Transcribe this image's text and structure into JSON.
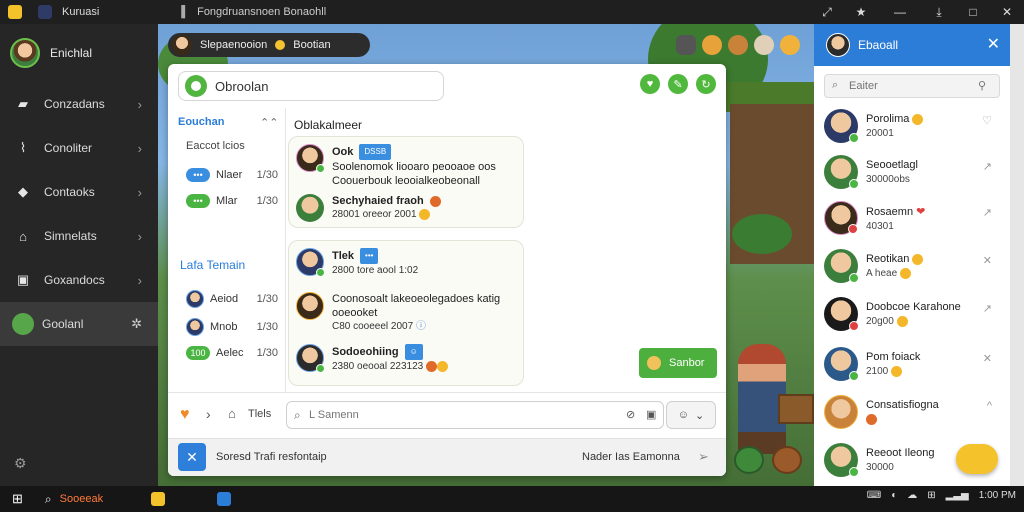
{
  "titlebar": {
    "title": "Kuruasi",
    "tab_title": "Fongdruansnoen Bonaohll",
    "controls": [
      "⤢",
      "★",
      "—",
      "⤓",
      "□",
      "✕"
    ]
  },
  "sidebar": {
    "profile_name": "Enichlal",
    "items": [
      {
        "label": "Conzadans",
        "icon": "contacts-icon"
      },
      {
        "label": "Conoliter",
        "icon": "activity-icon"
      },
      {
        "label": "Contaoks",
        "icon": "chat-icon"
      },
      {
        "label": "Simnelats",
        "icon": "home-icon"
      },
      {
        "label": "Goxandocs",
        "icon": "bag-icon"
      },
      {
        "label": "Goolanl",
        "icon": "game-icon",
        "active": true
      }
    ]
  },
  "game_bar": {
    "name": "Slepaenooion",
    "badge": "Bootian"
  },
  "chat": {
    "header_title": "Obroolan",
    "lists": {
      "section1_title": "Eouchan",
      "section1_sub": "Eaccot lcios",
      "section1_rows": [
        {
          "pill": "•••",
          "name": "Nlaer",
          "time": "1/30",
          "pill_color": "#3a8ee0"
        },
        {
          "pill": "•••",
          "name": "Mlar",
          "time": "1/30",
          "pill_color": "#4bb543"
        }
      ],
      "section2_title": "Lafa Temain",
      "section2_rows": [
        {
          "pill": "",
          "name": "Aeiod",
          "time": "1/30",
          "pill_color": "#3a8ee0"
        },
        {
          "pill": "",
          "name": "Mnob",
          "time": "1/30",
          "pill_color": "#3a8ee0"
        },
        {
          "pill": "100",
          "name": "Aelec",
          "time": "1/30",
          "pill_color": "#4bb543"
        }
      ]
    },
    "conversation_title": "Oblakalmeer",
    "messages": [
      {
        "name": "Ook",
        "tag": "DSSB",
        "text": "Soolenomok liooaro peooaoe oos Coouerbouk leooialkeobeonall",
        "meta": ""
      },
      {
        "name": "",
        "tag": "",
        "text": "Sechyhaied fraoh",
        "meta": "28001 oreeor 2001"
      },
      {
        "name": "Tlek",
        "tag": "•••",
        "text": "",
        "meta": "2800 tore aool 1:02"
      },
      {
        "name": "",
        "tag": "",
        "text": "Coonosoalt lakeoeolegadoes katig ooeooket",
        "meta": "C80 cooeeel 2007"
      },
      {
        "name": "Sodoeohiing",
        "tag": "☺",
        "text": "",
        "meta": "2380 oeooal 223123"
      }
    ],
    "send_button": "Sanbor",
    "input": {
      "label": "Tlels",
      "placeholder": "L Samenn"
    },
    "footer": {
      "left_text": "Soresd Trafi resfontaip",
      "right_text": "Nader  Ias  Eamonna"
    }
  },
  "contacts": {
    "header_name": "Ebaoall",
    "search_placeholder": "Eaiter",
    "items": [
      {
        "name": "Porolima",
        "sub": "20001",
        "status": "#4bb543",
        "action": "♡"
      },
      {
        "name": "Seooetlagl",
        "sub": "30000obs",
        "status": "#4bb543",
        "action": "↗"
      },
      {
        "name": "Rosaemn",
        "sub": "40301",
        "status": "#e04040",
        "action": "↗"
      },
      {
        "name": "Reotikan",
        "sub": "A heae",
        "status": "#4bb543",
        "action": "✕"
      },
      {
        "name": "Doobcoe Karahone",
        "sub": "20g00",
        "status": "#e04040",
        "action": "↗"
      },
      {
        "name": "Pom foiack",
        "sub": "2100",
        "status": "#4bb543",
        "action": "✕"
      },
      {
        "name": "Consatisfiogna",
        "sub": "",
        "status": "#4bb543",
        "action": "^"
      },
      {
        "name": "Reeoot Ileong",
        "sub": "30000",
        "status": "#4bb543",
        "action": ""
      }
    ]
  },
  "taskbar": {
    "search_label": "Sooeeak",
    "tray": [
      "⌨",
      "◐",
      "☁",
      "⊞",
      "▂▃▅"
    ],
    "clock": "1:00 PM"
  },
  "colors": {
    "accent_blue": "#2b7dd8",
    "accent_green": "#4caf3e",
    "sidebar_bg": "#262626"
  }
}
